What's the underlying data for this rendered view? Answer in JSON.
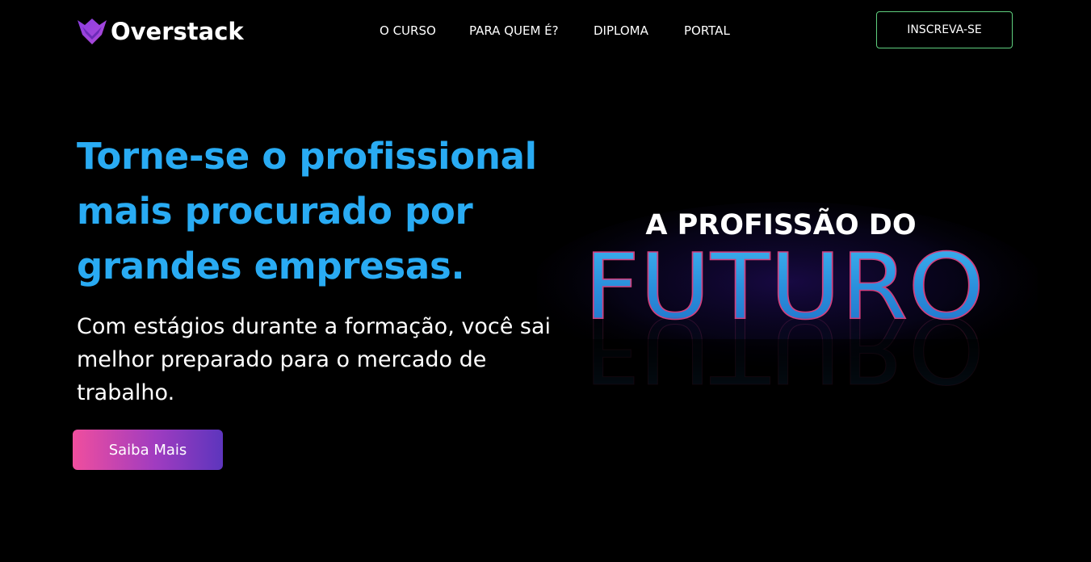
{
  "header": {
    "brand": "Overstack",
    "logo_icon": "fox-logo-icon",
    "nav": [
      {
        "label": "O CURSO"
      },
      {
        "label": "PARA QUEM É?"
      },
      {
        "label": "DIPLOMA"
      },
      {
        "label": "PORTAL"
      }
    ],
    "cta_label": "INSCREVA-SE"
  },
  "hero": {
    "title": "Torne-se o profissional mais procurado por grandes empresas.",
    "subtitle": "Com estágios durante a formação, você sai melhor preparado para o mercado de trabalho.",
    "button_label": "Saiba Mais"
  },
  "promo": {
    "line1": "A PROFISSÃO DO",
    "line2": "FUTURO"
  },
  "colors": {
    "background": "#000000",
    "accent_blue": "#29abf3",
    "cta_border": "#5fcf7e",
    "gradient_start": "#f04e9e",
    "gradient_end": "#5d35bd"
  }
}
